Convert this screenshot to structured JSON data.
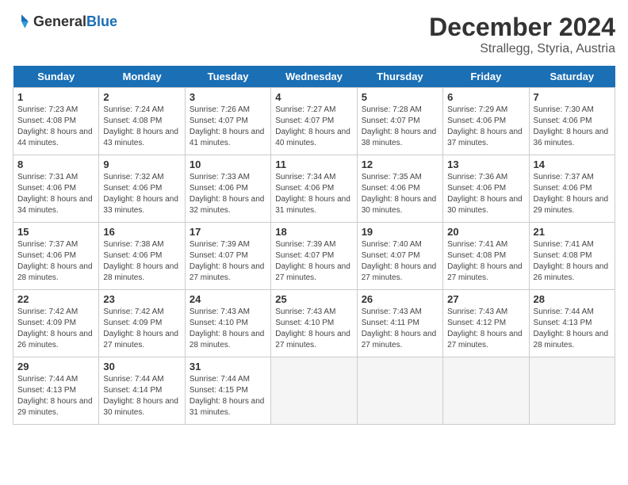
{
  "header": {
    "logo_general": "General",
    "logo_blue": "Blue",
    "month_year": "December 2024",
    "location": "Strallegg, Styria, Austria"
  },
  "days_of_week": [
    "Sunday",
    "Monday",
    "Tuesday",
    "Wednesday",
    "Thursday",
    "Friday",
    "Saturday"
  ],
  "weeks": [
    [
      {
        "day": "1",
        "sunrise": "Sunrise: 7:23 AM",
        "sunset": "Sunset: 4:08 PM",
        "daylight": "Daylight: 8 hours and 44 minutes."
      },
      {
        "day": "2",
        "sunrise": "Sunrise: 7:24 AM",
        "sunset": "Sunset: 4:08 PM",
        "daylight": "Daylight: 8 hours and 43 minutes."
      },
      {
        "day": "3",
        "sunrise": "Sunrise: 7:26 AM",
        "sunset": "Sunset: 4:07 PM",
        "daylight": "Daylight: 8 hours and 41 minutes."
      },
      {
        "day": "4",
        "sunrise": "Sunrise: 7:27 AM",
        "sunset": "Sunset: 4:07 PM",
        "daylight": "Daylight: 8 hours and 40 minutes."
      },
      {
        "day": "5",
        "sunrise": "Sunrise: 7:28 AM",
        "sunset": "Sunset: 4:07 PM",
        "daylight": "Daylight: 8 hours and 38 minutes."
      },
      {
        "day": "6",
        "sunrise": "Sunrise: 7:29 AM",
        "sunset": "Sunset: 4:06 PM",
        "daylight": "Daylight: 8 hours and 37 minutes."
      },
      {
        "day": "7",
        "sunrise": "Sunrise: 7:30 AM",
        "sunset": "Sunset: 4:06 PM",
        "daylight": "Daylight: 8 hours and 36 minutes."
      }
    ],
    [
      {
        "day": "8",
        "sunrise": "Sunrise: 7:31 AM",
        "sunset": "Sunset: 4:06 PM",
        "daylight": "Daylight: 8 hours and 34 minutes."
      },
      {
        "day": "9",
        "sunrise": "Sunrise: 7:32 AM",
        "sunset": "Sunset: 4:06 PM",
        "daylight": "Daylight: 8 hours and 33 minutes."
      },
      {
        "day": "10",
        "sunrise": "Sunrise: 7:33 AM",
        "sunset": "Sunset: 4:06 PM",
        "daylight": "Daylight: 8 hours and 32 minutes."
      },
      {
        "day": "11",
        "sunrise": "Sunrise: 7:34 AM",
        "sunset": "Sunset: 4:06 PM",
        "daylight": "Daylight: 8 hours and 31 minutes."
      },
      {
        "day": "12",
        "sunrise": "Sunrise: 7:35 AM",
        "sunset": "Sunset: 4:06 PM",
        "daylight": "Daylight: 8 hours and 30 minutes."
      },
      {
        "day": "13",
        "sunrise": "Sunrise: 7:36 AM",
        "sunset": "Sunset: 4:06 PM",
        "daylight": "Daylight: 8 hours and 30 minutes."
      },
      {
        "day": "14",
        "sunrise": "Sunrise: 7:37 AM",
        "sunset": "Sunset: 4:06 PM",
        "daylight": "Daylight: 8 hours and 29 minutes."
      }
    ],
    [
      {
        "day": "15",
        "sunrise": "Sunrise: 7:37 AM",
        "sunset": "Sunset: 4:06 PM",
        "daylight": "Daylight: 8 hours and 28 minutes."
      },
      {
        "day": "16",
        "sunrise": "Sunrise: 7:38 AM",
        "sunset": "Sunset: 4:06 PM",
        "daylight": "Daylight: 8 hours and 28 minutes."
      },
      {
        "day": "17",
        "sunrise": "Sunrise: 7:39 AM",
        "sunset": "Sunset: 4:07 PM",
        "daylight": "Daylight: 8 hours and 27 minutes."
      },
      {
        "day": "18",
        "sunrise": "Sunrise: 7:39 AM",
        "sunset": "Sunset: 4:07 PM",
        "daylight": "Daylight: 8 hours and 27 minutes."
      },
      {
        "day": "19",
        "sunrise": "Sunrise: 7:40 AM",
        "sunset": "Sunset: 4:07 PM",
        "daylight": "Daylight: 8 hours and 27 minutes."
      },
      {
        "day": "20",
        "sunrise": "Sunrise: 7:41 AM",
        "sunset": "Sunset: 4:08 PM",
        "daylight": "Daylight: 8 hours and 27 minutes."
      },
      {
        "day": "21",
        "sunrise": "Sunrise: 7:41 AM",
        "sunset": "Sunset: 4:08 PM",
        "daylight": "Daylight: 8 hours and 26 minutes."
      }
    ],
    [
      {
        "day": "22",
        "sunrise": "Sunrise: 7:42 AM",
        "sunset": "Sunset: 4:09 PM",
        "daylight": "Daylight: 8 hours and 26 minutes."
      },
      {
        "day": "23",
        "sunrise": "Sunrise: 7:42 AM",
        "sunset": "Sunset: 4:09 PM",
        "daylight": "Daylight: 8 hours and 27 minutes."
      },
      {
        "day": "24",
        "sunrise": "Sunrise: 7:43 AM",
        "sunset": "Sunset: 4:10 PM",
        "daylight": "Daylight: 8 hours and 28 minutes."
      },
      {
        "day": "25",
        "sunrise": "Sunrise: 7:43 AM",
        "sunset": "Sunset: 4:10 PM",
        "daylight": "Daylight: 8 hours and 27 minutes."
      },
      {
        "day": "26",
        "sunrise": "Sunrise: 7:43 AM",
        "sunset": "Sunset: 4:11 PM",
        "daylight": "Daylight: 8 hours and 27 minutes."
      },
      {
        "day": "27",
        "sunrise": "Sunrise: 7:43 AM",
        "sunset": "Sunset: 4:12 PM",
        "daylight": "Daylight: 8 hours and 27 minutes."
      },
      {
        "day": "28",
        "sunrise": "Sunrise: 7:44 AM",
        "sunset": "Sunset: 4:13 PM",
        "daylight": "Daylight: 8 hours and 28 minutes."
      }
    ],
    [
      {
        "day": "29",
        "sunrise": "Sunrise: 7:44 AM",
        "sunset": "Sunset: 4:13 PM",
        "daylight": "Daylight: 8 hours and 29 minutes."
      },
      {
        "day": "30",
        "sunrise": "Sunrise: 7:44 AM",
        "sunset": "Sunset: 4:14 PM",
        "daylight": "Daylight: 8 hours and 30 minutes."
      },
      {
        "day": "31",
        "sunrise": "Sunrise: 7:44 AM",
        "sunset": "Sunset: 4:15 PM",
        "daylight": "Daylight: 8 hours and 31 minutes."
      },
      null,
      null,
      null,
      null
    ]
  ]
}
